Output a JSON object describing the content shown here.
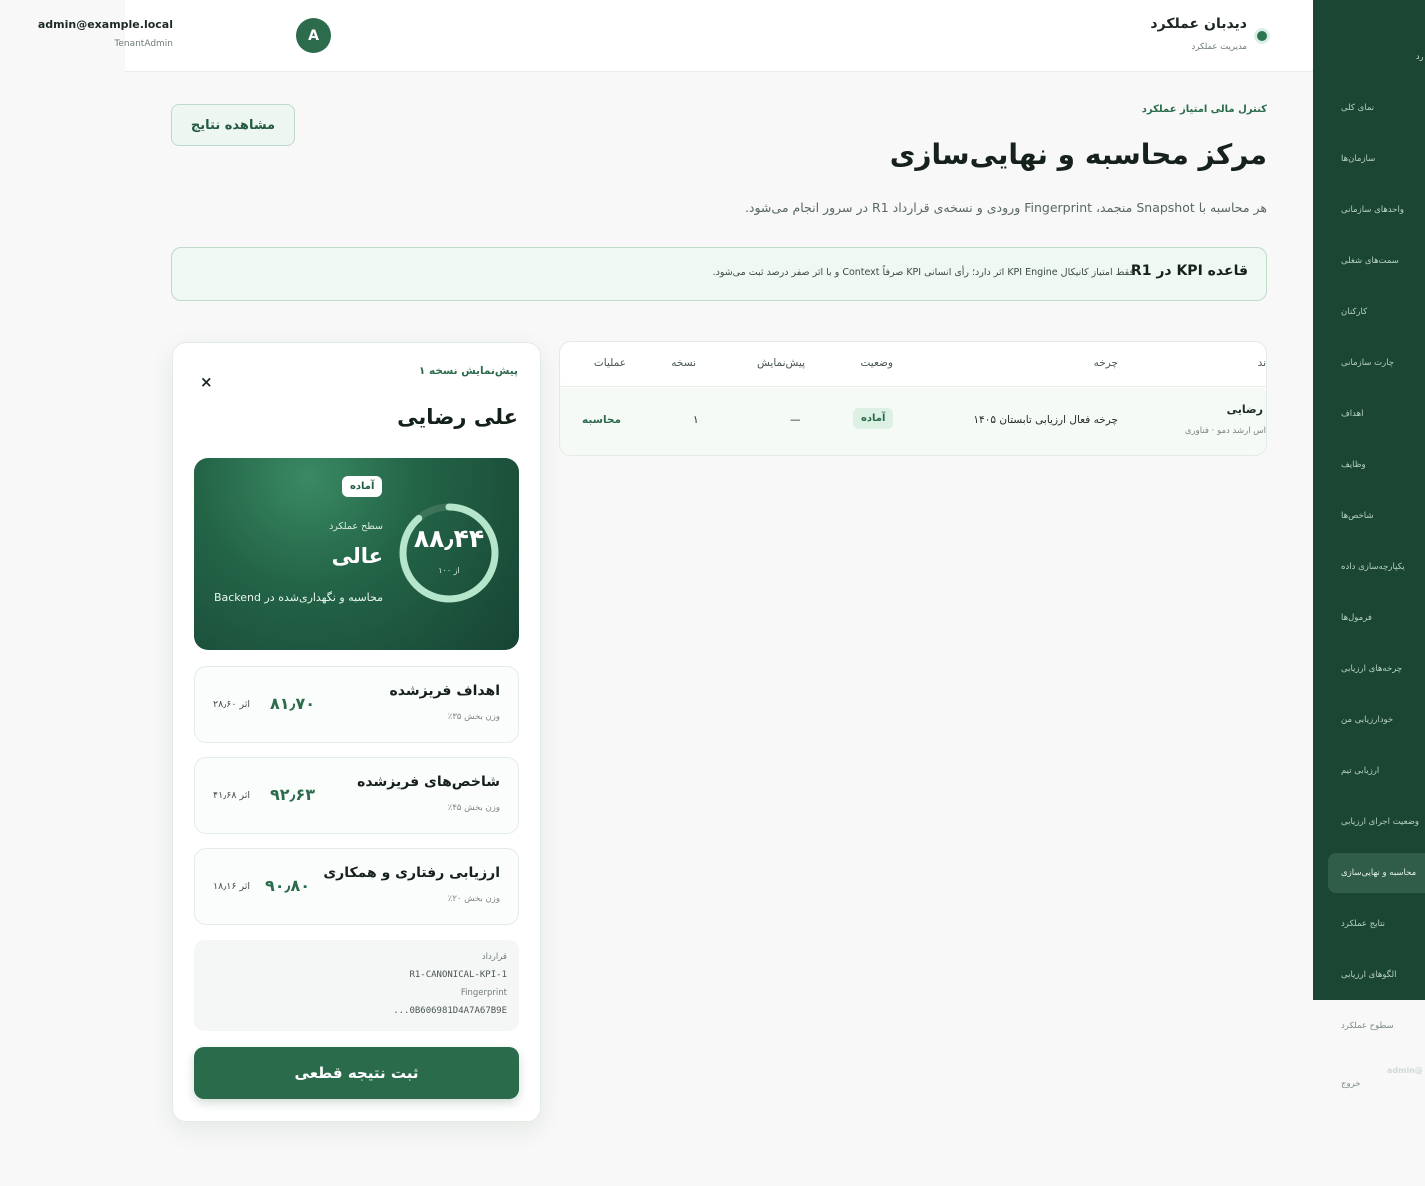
{
  "sidebar": {
    "top_fragment": "رد",
    "items": [
      {
        "label": "نمای کلی"
      },
      {
        "label": "سازمان‌ها"
      },
      {
        "label": "واحدهای سازمانی"
      },
      {
        "label": "سمت‌های شغلی"
      },
      {
        "label": "کارکنان"
      },
      {
        "label": "چارت سازمانی"
      },
      {
        "label": "اهداف"
      },
      {
        "label": "وظایف"
      },
      {
        "label": "شاخص‌ها"
      },
      {
        "label": "یکپارچه‌سازی داده"
      },
      {
        "label": "فرمول‌ها"
      },
      {
        "label": "چرخه‌های ارزیابی"
      },
      {
        "label": "خودارزیابی من"
      },
      {
        "label": "ارزیابی تیم"
      },
      {
        "label": "وضعیت اجرای ارزیابی"
      },
      {
        "label": "محاسبه و نهایی‌سازی"
      },
      {
        "label": "نتایج عملکرد"
      },
      {
        "label": "الگوهای ارزیابی"
      },
      {
        "label": "سطوح عملکرد"
      },
      {
        "label": "خروج"
      }
    ],
    "ghost_text": "admin@"
  },
  "header": {
    "brand_title": "دیدبان عملکرد",
    "brand_subtitle": "مدیریت عملکرد",
    "avatar_letter": "A",
    "user_email": "admin@example.local",
    "user_role": "TenantAdmin"
  },
  "page": {
    "eyebrow": "کنترل مالی امتیاز عملکرد",
    "title": "مرکز محاسبه و نهایی‌سازی",
    "description": "هر محاسبه با Snapshot منجمد، Fingerprint ورودی و نسخه‌ی قرارداد R1 در سرور انجام می‌شود.",
    "results_button": "مشاهده نتایج"
  },
  "rule": {
    "title": "قاعده KPI در R1",
    "text": "فقط امتیاز کانیکال KPI Engine اثر دارد؛ رأی انسانی KPI صرفاً Context و با اثر صفر درصد ثبت می‌شود."
  },
  "table": {
    "headers": {
      "col1": "ند",
      "cycle": "چرخه",
      "status": "وضعیت",
      "preview": "پیش‌نمایش",
      "version": "نسخه",
      "actions": "عملیات"
    },
    "rows": [
      {
        "name": "رضایی",
        "sub": "اس ارشد دمو · فناوری",
        "cycle": "چرخه فعال ارزیابی تابستان ۱۴۰۵",
        "status": "آماده",
        "preview": "—",
        "version": "۱",
        "action": "محاسبه"
      }
    ]
  },
  "preview": {
    "label": "پیش‌نمایش نسخه ۱",
    "close": "×",
    "name": "علی رضایی",
    "status_badge": "آماده",
    "level_label": "سطح عملکرد",
    "level": "عالی",
    "description": "محاسبه و نگهداری‌شده در Backend",
    "score": "۸۸٫۴۴",
    "score_sub": "از ۱۰۰",
    "score_fraction": 0.8844,
    "components": [
      {
        "title": "اهداف فریزشده",
        "weight": "وزن بخش ۳۵٪",
        "score": "۸۱٫۷۰",
        "effect": "اثر ۲۸٫۶۰"
      },
      {
        "title": "شاخص‌های فریزشده",
        "weight": "وزن بخش ۴۵٪",
        "score": "۹۲٫۶۳",
        "effect": "اثر ۴۱٫۶۸"
      },
      {
        "title": "ارزیابی رفتاری و همکاری",
        "weight": "وزن بخش ۲۰٪",
        "score": "۹۰٫۸۰",
        "effect": "اثر ۱۸٫۱۶"
      }
    ],
    "contract_label": "قرارداد",
    "contract_value": "R1-CANONICAL-KPI-1",
    "fingerprint_label": "Fingerprint",
    "fingerprint_value": "...0B606981D4A7A67B9E",
    "submit_button": "ثبت نتیجه قطعی"
  },
  "colors": {
    "brand_dark": "#1c4634",
    "brand": "#2c6b4c",
    "accent_light": "#eff8f3"
  }
}
